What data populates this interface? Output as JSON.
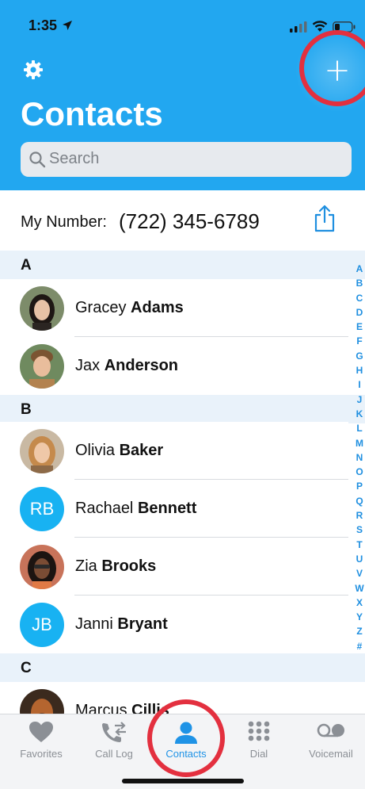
{
  "status_bar": {
    "time": "1:35"
  },
  "header": {
    "title": "Contacts",
    "search_placeholder": "Search",
    "add_label": "+"
  },
  "my_number": {
    "label": "My Number:",
    "value": "(722) 345-6789"
  },
  "sections": [
    {
      "letter": "A"
    },
    {
      "letter": "B"
    },
    {
      "letter": "C"
    }
  ],
  "contacts": [
    {
      "first": "Gracey",
      "last": "Adams",
      "avatar": "photo"
    },
    {
      "first": "Jax",
      "last": "Anderson",
      "avatar": "photo"
    },
    {
      "first": "Olivia",
      "last": "Baker",
      "avatar": "photo"
    },
    {
      "first": "Rachael ",
      "last": "Bennett",
      "avatar": "initials",
      "initials": "RB"
    },
    {
      "first": "Zia",
      "last": "Brooks",
      "avatar": "photo"
    },
    {
      "first": "Janni",
      "last": "Bryant",
      "avatar": "initials",
      "initials": "JB"
    },
    {
      "first": "Marcus",
      "last": "Cillis",
      "avatar": "photo"
    }
  ],
  "alphabet": [
    "A",
    "B",
    "C",
    "D",
    "E",
    "F",
    "G",
    "H",
    "I",
    "J",
    "K",
    "L",
    "M",
    "N",
    "O",
    "P",
    "Q",
    "R",
    "S",
    "T",
    "U",
    "V",
    "W",
    "X",
    "Y",
    "Z",
    "#"
  ],
  "tabs": [
    {
      "label": "Favorites",
      "icon": "heart-icon"
    },
    {
      "label": "Call Log",
      "icon": "call-log-icon"
    },
    {
      "label": "Contacts",
      "icon": "person-icon",
      "active": true
    },
    {
      "label": "Dial",
      "icon": "keypad-icon"
    },
    {
      "label": "Voicemail",
      "icon": "voicemail-icon"
    }
  ],
  "colors": {
    "header_bg": "#22a7f0",
    "accent": "#1f93e6",
    "highlight_ring": "#e3303f",
    "section_bg": "#e9f2fa"
  }
}
